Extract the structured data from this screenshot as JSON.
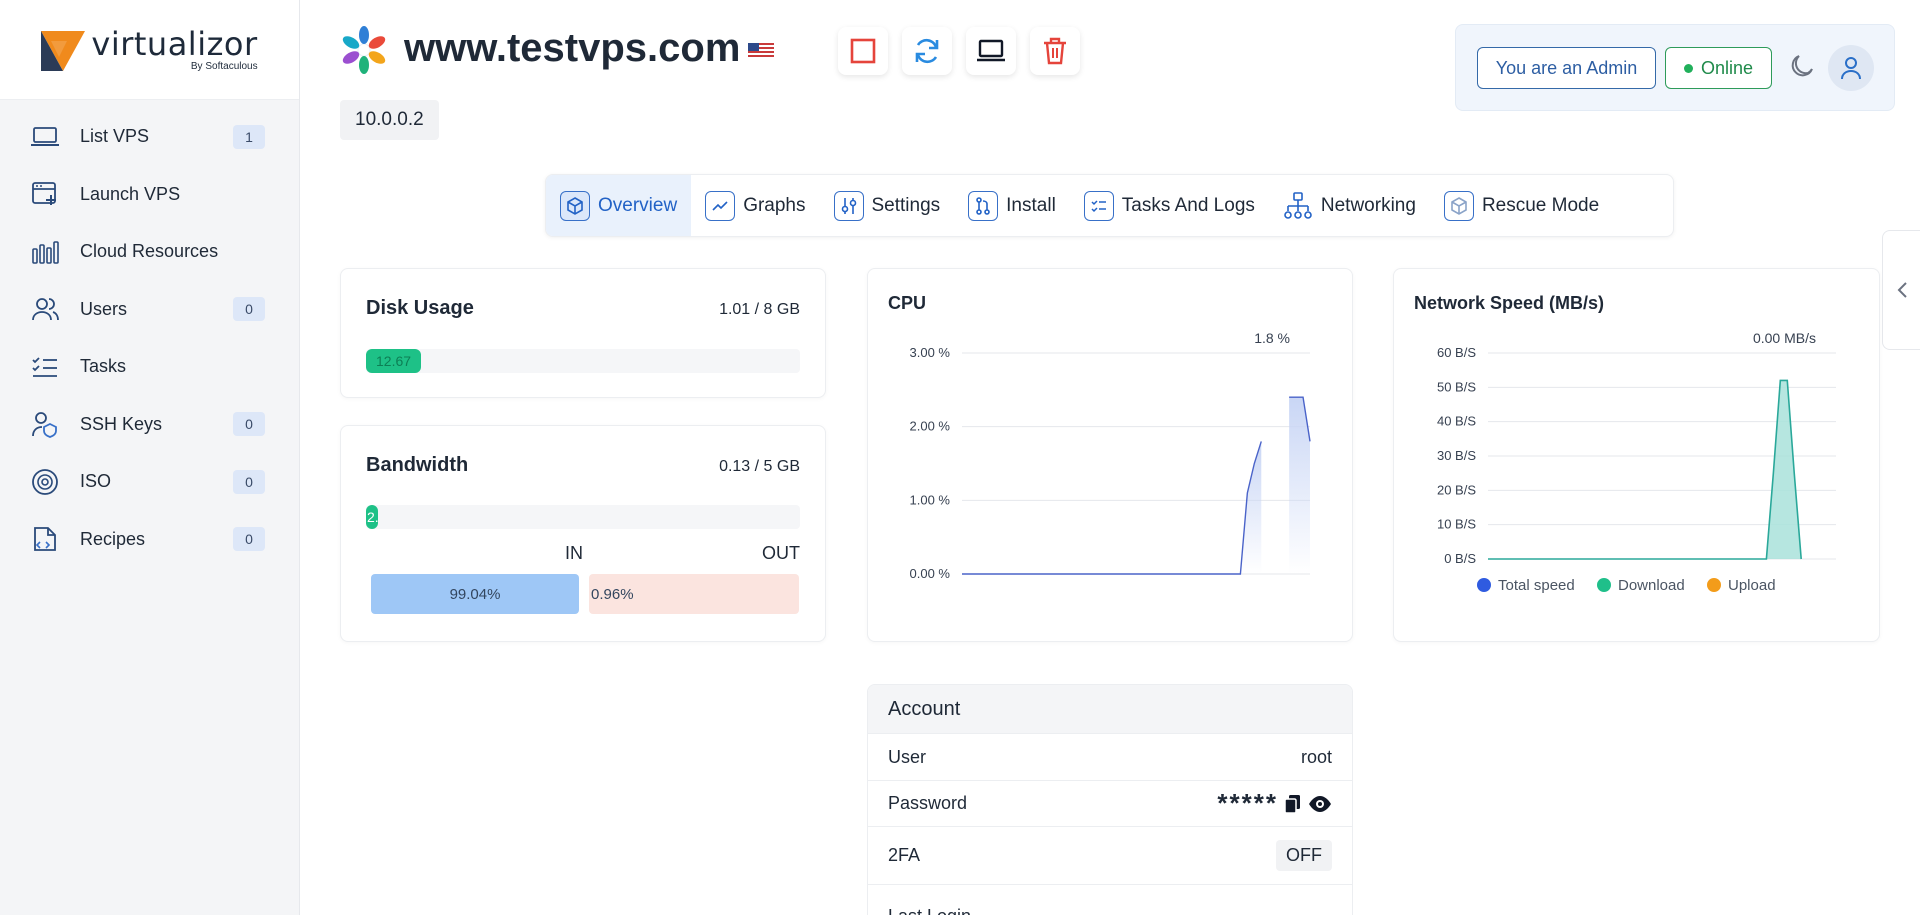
{
  "brand": {
    "name": "virtualizor",
    "sub": "By Softaculous"
  },
  "sidebar": {
    "items": [
      {
        "label": "List VPS",
        "badge": "1",
        "icon": "laptop-icon"
      },
      {
        "label": "Launch VPS",
        "badge": "",
        "icon": "launch-icon"
      },
      {
        "label": "Cloud Resources",
        "badge": "",
        "icon": "bar-chart-icon"
      },
      {
        "label": "Users",
        "badge": "0",
        "icon": "users-icon"
      },
      {
        "label": "Tasks",
        "badge": "",
        "icon": "tasks-icon"
      },
      {
        "label": "SSH Keys",
        "badge": "0",
        "icon": "key-user-icon"
      },
      {
        "label": "ISO",
        "badge": "0",
        "icon": "disc-icon"
      },
      {
        "label": "Recipes",
        "badge": "0",
        "icon": "recipe-icon"
      }
    ]
  },
  "header": {
    "hostname": "www.testvps.com",
    "ip": "10.0.0.2",
    "admin_label": "You are an Admin",
    "status_label": "Online"
  },
  "tabs": [
    {
      "label": "Overview",
      "active": true
    },
    {
      "label": "Graphs"
    },
    {
      "label": "Settings"
    },
    {
      "label": "Install"
    },
    {
      "label": "Tasks And Logs"
    },
    {
      "label": "Networking"
    },
    {
      "label": "Rescue Mode"
    }
  ],
  "disk": {
    "title": "Disk Usage",
    "value": "1.01 / 8 GB",
    "percent_label": "12.67",
    "percent": 12.67
  },
  "bandwidth": {
    "title": "Bandwidth",
    "value": "0.13 / 5 GB",
    "percent_label": "2.",
    "percent": 2.6,
    "in_label": "IN",
    "out_label": "OUT",
    "in_percent_label": "99.04%",
    "out_percent_label": "0.96%",
    "in_percent": 99.04,
    "out_percent": 0.96
  },
  "chart_data": [
    {
      "type": "area",
      "title": "CPU",
      "annotation": "1.8 %",
      "y_ticks": [
        "0.00 %",
        "1.00 %",
        "2.00 %",
        "3.00 %"
      ],
      "ylim": [
        0,
        3
      ],
      "x": [
        0,
        1,
        2,
        3,
        4,
        5,
        6,
        7,
        8,
        9,
        10,
        11,
        12,
        13,
        14,
        15,
        16,
        17,
        18,
        19,
        20,
        21,
        22,
        23,
        24,
        25,
        26,
        27,
        28,
        29,
        30,
        31,
        32,
        33,
        34,
        35,
        36,
        37,
        38,
        39,
        40,
        41,
        42,
        43,
        44,
        45,
        46,
        47,
        48,
        49,
        50
      ],
      "series": [
        {
          "values": [
            0,
            0,
            0,
            0,
            0,
            0,
            0,
            0,
            0,
            0,
            0,
            0,
            0,
            0,
            0,
            0,
            0,
            0,
            0,
            0,
            0,
            0,
            0,
            0,
            0,
            0,
            0,
            0,
            0,
            0,
            0,
            0,
            0,
            0,
            0,
            0,
            0,
            0,
            0,
            0,
            0,
            1.1,
            1.5,
            1.8,
            null,
            null,
            null,
            2.4,
            2.4,
            2.4,
            1.8
          ]
        }
      ],
      "color": "#4a63c9",
      "fill": "#c9d6f5"
    },
    {
      "type": "area",
      "title": "Network Speed (MB/s)",
      "annotation": "0.00 MB/s",
      "y_ticks": [
        "0 B/S",
        "10 B/S",
        "20 B/S",
        "30 B/S",
        "40 B/S",
        "50 B/S",
        "60 B/S"
      ],
      "ylim": [
        0,
        60
      ],
      "x": [
        0,
        1,
        2,
        3,
        4,
        5,
        6,
        7,
        8,
        9,
        10,
        11,
        12,
        13,
        14,
        15,
        16,
        17,
        18,
        19,
        20,
        21,
        22,
        23,
        24,
        25,
        26,
        27,
        28,
        29,
        30,
        31,
        32,
        33,
        34,
        35,
        36,
        37,
        38,
        39,
        40,
        41,
        42,
        43,
        44,
        45,
        46,
        47,
        48,
        49,
        50
      ],
      "series": [
        {
          "name": "Total speed",
          "color": "#2f5be0",
          "values": []
        },
        {
          "name": "Download",
          "color": "#1fbf8a",
          "values": [
            0,
            0,
            0,
            0,
            0,
            0,
            0,
            0,
            0,
            0,
            0,
            0,
            0,
            0,
            0,
            0,
            0,
            0,
            0,
            0,
            0,
            0,
            0,
            0,
            0,
            0,
            0,
            0,
            0,
            0,
            0,
            0,
            0,
            0,
            0,
            0,
            0,
            0,
            0,
            0,
            0,
            25,
            52,
            52,
            25,
            0,
            null,
            null,
            null,
            null,
            null
          ]
        },
        {
          "name": "Upload",
          "color": "#f39c1a",
          "values": []
        }
      ],
      "fill": "#a9e2da",
      "line": "#2aa89a"
    }
  ],
  "account": {
    "title": "Account",
    "rows": [
      {
        "label": "User",
        "value": "root"
      },
      {
        "label": "Password",
        "value": "*****"
      },
      {
        "label": "2FA",
        "value": "OFF"
      },
      {
        "label": "Last Login",
        "value": ""
      }
    ]
  },
  "colors": {
    "accent": "#2262c6",
    "online": "#21b05b",
    "disk_fill": "#1ec187",
    "danger": "#e5443b"
  }
}
